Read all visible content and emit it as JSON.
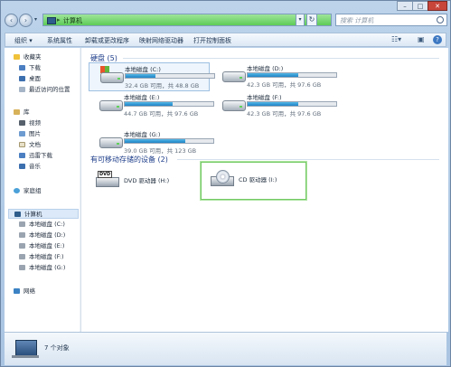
{
  "window": {
    "min_label": "–",
    "max_label": "□",
    "close_label": "✕"
  },
  "address": {
    "separator": "▸",
    "path": "计算机",
    "dropdown": "▾",
    "refresh": "↻"
  },
  "search": {
    "placeholder": "搜索 计算机"
  },
  "toolbar": {
    "organize": "组织 ▾",
    "system_properties": "系统属性",
    "uninstall": "卸载或更改程序",
    "map_drive": "映射网络驱动器",
    "control_panel": "打开控制面板",
    "view_icon": "view-icon",
    "pane_icon": "pane-icon",
    "help_icon": "help-icon"
  },
  "nav": {
    "favorites": "收藏夹",
    "downloads": "下载",
    "desktop": "桌面",
    "recent": "最近访问的位置",
    "libraries": "库",
    "videos": "视频",
    "pictures": "图片",
    "documents": "文档",
    "thunder": "迅雷下载",
    "music": "音乐",
    "homegroup": "家庭组",
    "computer": "计算机",
    "drive_c": "本地磁盘 (C:)",
    "drive_d": "本地磁盘 (D:)",
    "drive_e": "本地磁盘 (E:)",
    "drive_f": "本地磁盘 (F:)",
    "drive_g": "本地磁盘 (G:)",
    "network": "网络"
  },
  "main": {
    "hdd_group": "硬盘 (5)",
    "removable_group": "有可移动存储的设备 (2)",
    "drives": [
      {
        "name": "本地磁盘 (C:)",
        "info": "32.4 GB 可用，共 48.8 GB",
        "used_fraction": 0.34
      },
      {
        "name": "本地磁盘 (D:)",
        "info": "42.3 GB 可用，共 97.6 GB",
        "used_fraction": 0.57
      },
      {
        "name": "本地磁盘 (E:)",
        "info": "44.7 GB 可用，共 97.6 GB",
        "used_fraction": 0.54
      },
      {
        "name": "本地磁盘 (F:)",
        "info": "42.3 GB 可用，共 97.6 GB",
        "used_fraction": 0.57
      },
      {
        "name": "本地磁盘 (G:)",
        "info": "39.0 GB 可用，共 123 GB",
        "used_fraction": 0.68
      }
    ],
    "dvd": {
      "name": "DVD 驱动器 (H:)",
      "badge": "DVD"
    },
    "cd": {
      "name": "CD 驱动器 (I:)"
    }
  },
  "status": {
    "count": "7 个对象"
  }
}
